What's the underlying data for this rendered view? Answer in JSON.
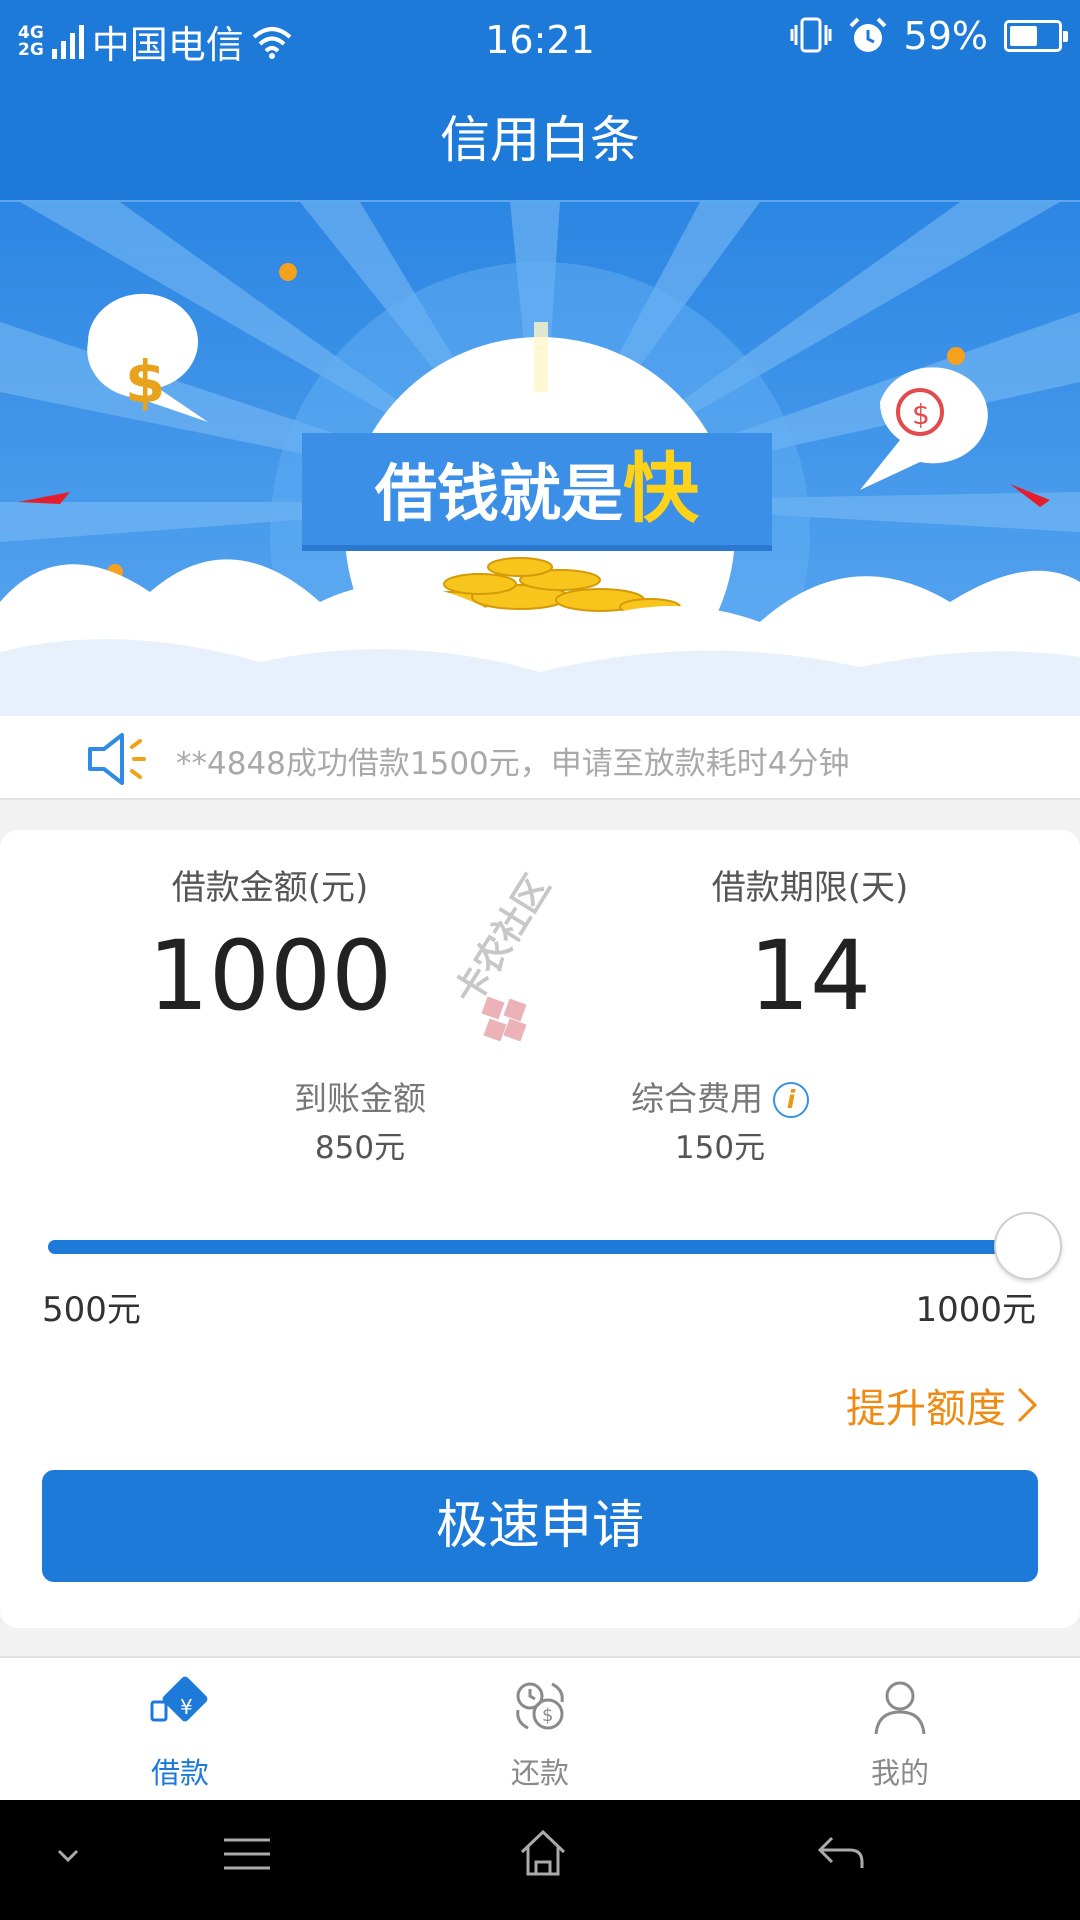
{
  "status": {
    "network_top": "4G",
    "network_bottom": "2G",
    "carrier": "中国电信",
    "time": "16:21",
    "battery": "59%",
    "battery_level": 0.59
  },
  "header": {
    "title": "信用白条"
  },
  "banner": {
    "slogan": "借钱就是",
    "slogan_highlight": "快"
  },
  "notice": {
    "text": "**4848成功借款1500元，申请至放款耗时4分钟"
  },
  "loan": {
    "amount_label": "借款金额(元)",
    "amount_value": "1000",
    "term_label": "借款期限(天)",
    "term_value": "14",
    "received_label": "到账金额",
    "received_value": "850元",
    "fee_label": "综合费用",
    "fee_value": "150元",
    "info_glyph": "i",
    "slider_min": "500元",
    "slider_max": "1000元",
    "slider_fraction": 1.0,
    "raise_label": "提升额度",
    "apply_label": "极速申请"
  },
  "watermark": {
    "text": "卡农社区"
  },
  "tabs": [
    {
      "label": "借款",
      "icon": "loan-icon",
      "active": true
    },
    {
      "label": "还款",
      "icon": "repay-icon",
      "active": false
    },
    {
      "label": "我的",
      "icon": "user-icon",
      "active": false
    }
  ],
  "colors": {
    "primary": "#1d7ad9",
    "accent": "#ef8a12",
    "highlight": "#ffd21a"
  }
}
